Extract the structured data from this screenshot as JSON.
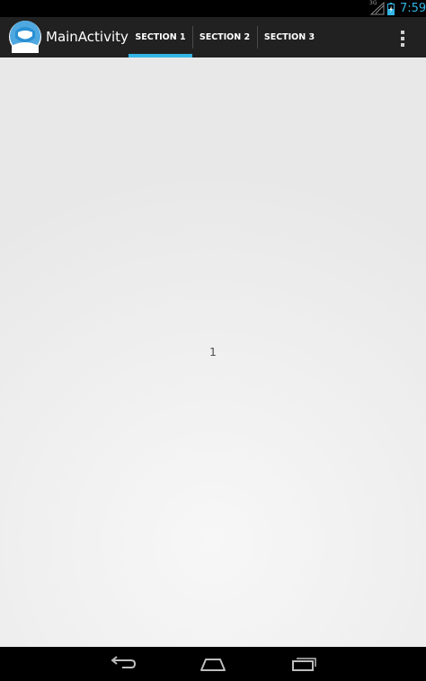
{
  "status_bar": {
    "network_type": "3G",
    "time": "7:59",
    "signal_icon": "signal-no-bars-icon",
    "battery_icon": "battery-charging-icon",
    "accent_color": "#33b5e5"
  },
  "action_bar": {
    "app_icon": "app-logo-icon",
    "title": "MainActivity",
    "tabs": [
      {
        "label": "SECTION 1",
        "selected": true
      },
      {
        "label": "SECTION 2",
        "selected": false
      },
      {
        "label": "SECTION 3",
        "selected": false
      }
    ],
    "overflow_icon": "overflow-menu-icon",
    "indicator_color": "#33b5e5"
  },
  "content": {
    "section_number": "1"
  },
  "nav_bar": {
    "back_icon": "back-icon",
    "home_icon": "home-icon",
    "recent_apps_icon": "recent-apps-icon"
  }
}
